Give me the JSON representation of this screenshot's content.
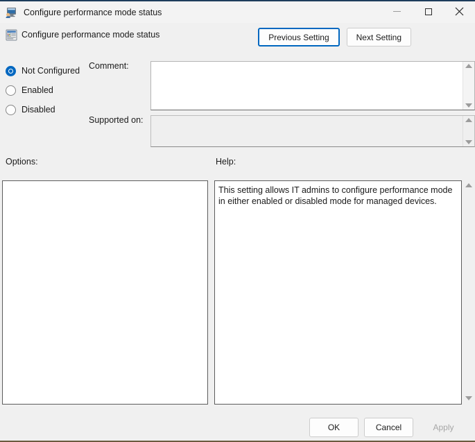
{
  "window": {
    "title": "Configure performance mode status",
    "icon": "computer-user-icon",
    "controls": {
      "minimize": "minimize-icon",
      "maximize": "maximize-icon",
      "close_label": "✕"
    }
  },
  "header": {
    "icon": "policy-setting-icon",
    "title": "Configure performance mode status",
    "previous_button": "Previous Setting",
    "next_button": "Next Setting"
  },
  "state": {
    "options": [
      "Not Configured",
      "Enabled",
      "Disabled"
    ],
    "selected": "Not Configured"
  },
  "fields": {
    "comment_label": "Comment:",
    "comment_value": "",
    "supported_on_label": "Supported on:",
    "supported_on_value": ""
  },
  "panels": {
    "options_label": "Options:",
    "options_value": "",
    "help_label": "Help:",
    "help_text": "This setting allows IT admins to configure performance mode in either enabled or disabled mode for managed devices."
  },
  "footer": {
    "ok": "OK",
    "cancel": "Cancel",
    "apply": "Apply",
    "apply_enabled": false
  },
  "colors": {
    "accent": "#0067c0",
    "dialog_bg": "#f0f0f0",
    "titlebar_bg": "#f3f3f3",
    "field_border": "#5c5c5c",
    "disabled_text": "#a6a6a6"
  }
}
